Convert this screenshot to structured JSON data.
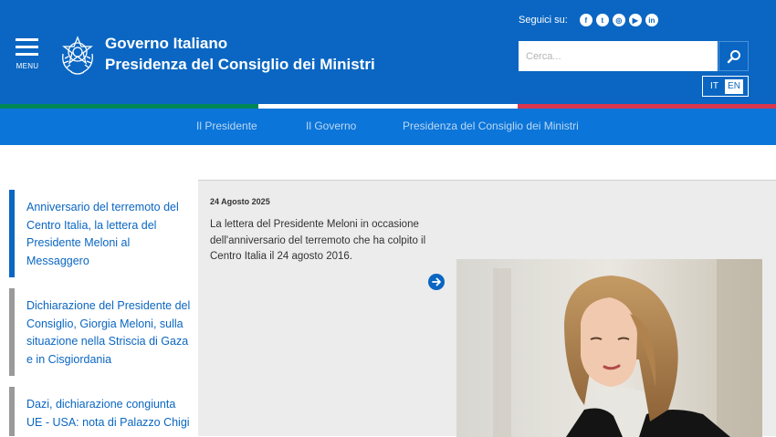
{
  "header": {
    "menu_label": "MENU",
    "brand_line1": "Governo Italiano",
    "brand_line2": "Presidenza del Consiglio dei Ministri",
    "follow_label": "Seguici su:",
    "social": [
      {
        "name": "facebook-icon",
        "glyph": "f"
      },
      {
        "name": "twitter-icon",
        "glyph": "t"
      },
      {
        "name": "instagram-icon",
        "glyph": "◎"
      },
      {
        "name": "youtube-icon",
        "glyph": "▶"
      },
      {
        "name": "linkedin-icon",
        "glyph": "in"
      }
    ],
    "search_placeholder": "Cerca...",
    "languages": [
      {
        "code": "IT",
        "active": false
      },
      {
        "code": "EN",
        "active": true
      }
    ]
  },
  "colors": {
    "brand_blue": "#0a66c2",
    "nav_blue": "#0b75d9",
    "italy_green": "#008758",
    "italy_white": "#ffffff",
    "italy_red": "#d9364f",
    "accent_active": "#0a66c2",
    "accent_inactive": "#9a9a9a"
  },
  "nav": {
    "items": [
      "Il Presidente",
      "Il Governo",
      "Presidenza del Consiglio dei Ministri"
    ]
  },
  "sidebar": {
    "items": [
      {
        "title": "Anniversario del terremoto del Centro Italia, la lettera del Presidente Meloni al Messaggero",
        "active": true
      },
      {
        "title": "Dichiarazione del Presidente del Consiglio, Giorgia Meloni, sulla situazione nella Striscia di Gaza e in Cisgiordania",
        "active": false
      },
      {
        "title": "Dazi, dichiarazione congiunta UE - USA: nota di Palazzo Chigi",
        "active": false
      }
    ]
  },
  "article": {
    "date": "24 Agosto 2025",
    "summary": "La lettera del Presidente Meloni in occasione dell'anniversario del terremoto che ha colpito il Centro Italia il 24 agosto 2016."
  }
}
